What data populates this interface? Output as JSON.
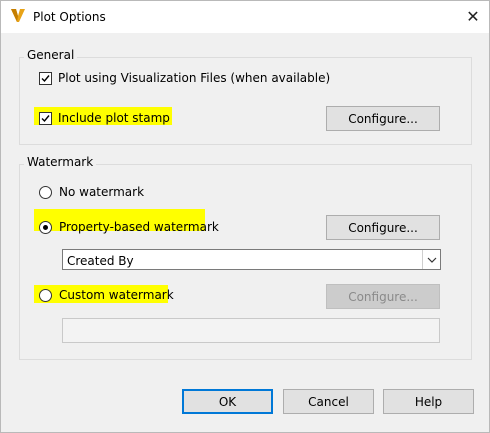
{
  "window": {
    "title": "Plot Options",
    "close_glyph": "✕",
    "app_icon": "autodesk-v-icon"
  },
  "general": {
    "legend": "General",
    "plot_vis_files_label": "Plot using Visualization Files (when available)",
    "plot_vis_files_checked": true,
    "include_stamp_label": "Include plot stamp",
    "include_stamp_checked": true,
    "configure_label": "Configure..."
  },
  "watermark": {
    "legend": "Watermark",
    "no_watermark_label": "No watermark",
    "property_based_label": "Property-based watermark",
    "custom_label": "Custom watermark",
    "selected": "property_based",
    "property_configure_label": "Configure...",
    "property_select_value": "Created By",
    "custom_configure_label": "Configure...",
    "custom_text_value": ""
  },
  "footer": {
    "ok_label": "OK",
    "cancel_label": "Cancel",
    "help_label": "Help"
  },
  "colors": {
    "highlight": "#ffff00",
    "accent": "#0078d7"
  }
}
